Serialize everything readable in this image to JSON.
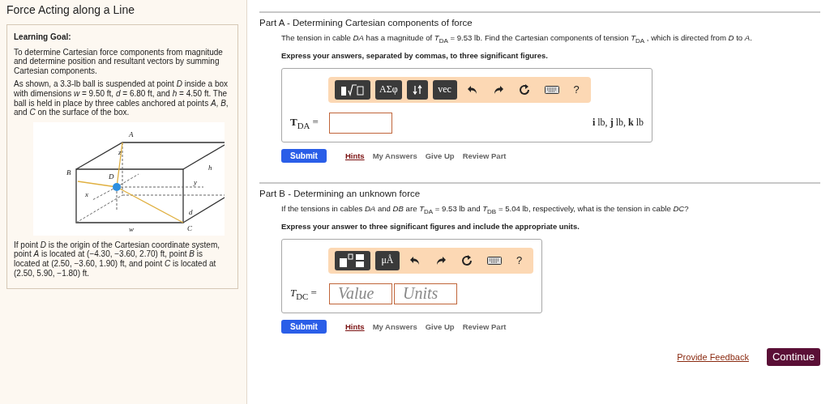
{
  "title": "Force Acting along a Line",
  "intro": {
    "heading": "Learning Goal:",
    "paragraphs": [
      "To determine Cartesian force components from magnitude and determine position and resultant vectors by summing Cartesian components.",
      "As shown, a 3.3-lb ball is suspended at point *D* inside a box with dimensions *w* = 9.50 ft, *d* = 6.80 ft, and *h* = 4.50 ft. The ball is held in place by three cables anchored at points *A*, *B*, and *C* on the surface of the box."
    ],
    "figure_labels": [
      "A",
      "B",
      "D",
      "z",
      "x",
      "y",
      "h",
      "d",
      "w",
      "C"
    ],
    "after": "If point *D* is the origin of the Cartesian coordinate system, point *A* is located at (−4.30, −3.60, 2.70) ft, point *B* is located at (2.50, −3.60, 1.90) ft, and point *C* is located at (2.50, 5.90, −1.80) ft."
  },
  "parts": [
    {
      "title": "Part A - Determining Cartesian components of force",
      "question": "The tension in cable *DA* has a magnitude of *T*$_{DA}$ = 9.53 lb. Find the Cartesian components of tension *T*$_{DA}$ , which is directed from *D* to *A*.",
      "instruction": "Express your answers, separated by commas, to three significant figures.",
      "toolbar": [
        {
          "kind": "templates"
        },
        {
          "kind": "textdark",
          "label": "ΑΣφ"
        },
        {
          "kind": "sort"
        },
        {
          "kind": "textdark",
          "label": "vec"
        },
        {
          "kind": "undo"
        },
        {
          "kind": "redo"
        },
        {
          "kind": "reset"
        },
        {
          "kind": "keyboard"
        },
        {
          "kind": "textplain",
          "label": "?"
        }
      ],
      "answer_label": "**T**$_{DA}$ =",
      "fields": [
        {
          "kind": "input"
        }
      ],
      "units": "**i** lb, **j** lb, **k** lb",
      "actions": [
        "Submit",
        "Hints",
        "My Answers",
        "Give Up",
        "Review Part"
      ]
    },
    {
      "title": "Part B - Determining an unknown force",
      "question": "If the tensions in cables *DA* and *DB* are *T*$_{DA}$ = 9.53 lb and *T*$_{DB}$ = 5.04 lb, respectively, what is the tension in cable *DC*?",
      "instruction": "Express your answer to three significant figures and include the appropriate units.",
      "toolbar": [
        {
          "kind": "fraction"
        },
        {
          "kind": "textdark",
          "label": "μÅ"
        },
        {
          "kind": "undo"
        },
        {
          "kind": "redo"
        },
        {
          "kind": "reset"
        },
        {
          "kind": "keyboard"
        },
        {
          "kind": "textplain",
          "label": "?"
        }
      ],
      "answer_label": "*T*$_{DC}$ =",
      "fields": [
        {
          "kind": "input",
          "placeholder": "Value"
        },
        {
          "kind": "input",
          "placeholder": "Units"
        }
      ],
      "actions": [
        "Submit",
        "Hints",
        "My Answers",
        "Give Up",
        "Review Part"
      ]
    }
  ],
  "footer": {
    "feedback": "Provide Feedback",
    "continue": "Continue"
  }
}
